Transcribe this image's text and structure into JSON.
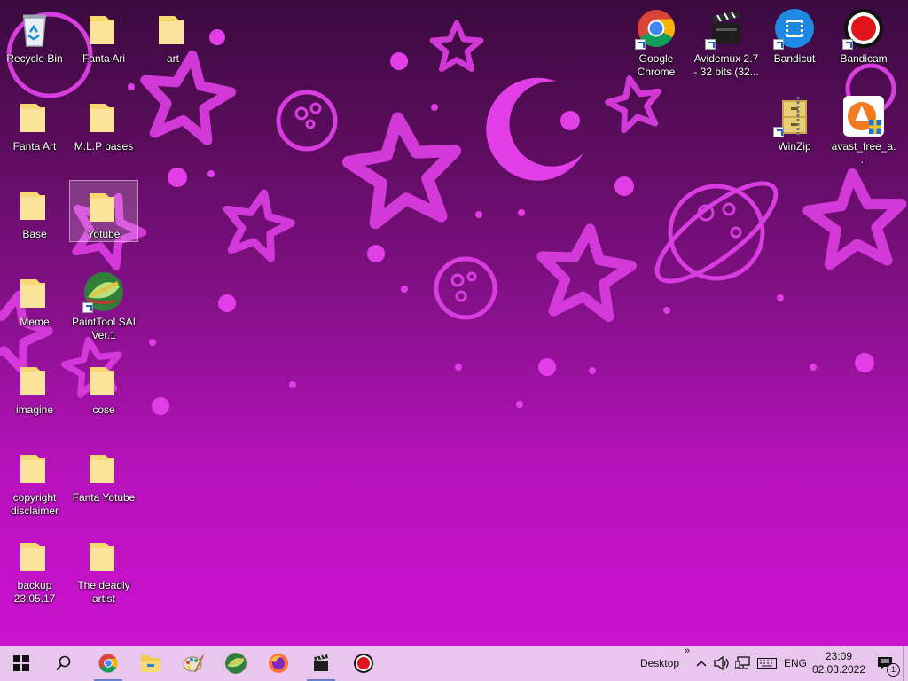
{
  "desktop": {
    "icons": [
      {
        "label": "Recycle Bin",
        "type": "recycle"
      },
      {
        "label": "Fanta Ari",
        "type": "folder"
      },
      {
        "label": "art",
        "type": "folder"
      },
      {
        "label": "Fanta Art",
        "type": "folder"
      },
      {
        "label": "M.L.P bases",
        "type": "folder"
      },
      {
        "label": "Base",
        "type": "folder"
      },
      {
        "label": "Yotube",
        "type": "folder"
      },
      {
        "label": "Meme",
        "type": "folder"
      },
      {
        "label": "PaintTool SAI Ver.1",
        "type": "app"
      },
      {
        "label": "imagine",
        "type": "folder"
      },
      {
        "label": "cose",
        "type": "folder"
      },
      {
        "label": "copyright disclaimer",
        "type": "folder"
      },
      {
        "label": "Fanta Yotube",
        "type": "folder"
      },
      {
        "label": "backup 23.05.17",
        "type": "folder"
      },
      {
        "label": "The deadly artist",
        "type": "folder"
      },
      {
        "label": "Google Chrome",
        "type": "shortcut"
      },
      {
        "label": "Avidemux 2.7 - 32 bits (32...",
        "type": "shortcut"
      },
      {
        "label": "Bandicut",
        "type": "shortcut"
      },
      {
        "label": "Bandicam",
        "type": "shortcut"
      },
      {
        "label": "WinZip",
        "type": "shortcut"
      },
      {
        "label": "avast_free_a...",
        "type": "app"
      }
    ],
    "selected": "Yotube"
  },
  "taskbar": {
    "pinned": [
      "windows-start-icon",
      "search-icon",
      "chrome-icon",
      "file-explorer-icon",
      "paint-palette-icon",
      "painttool-sai-icon",
      "firefox-icon",
      "avidemux-icon",
      "bandicam-icon"
    ],
    "active": [
      "chrome-icon",
      "avidemux-icon"
    ],
    "toolbar_label": "Desktop",
    "chevron": "»",
    "lang": "ENG",
    "time": "23:09",
    "date": "02.03.2022",
    "notification_count": "1"
  },
  "colors": {
    "taskbar": "#e9c6ee",
    "wallpaper_shapes": "#e23ee8",
    "folder": "#f8d775"
  }
}
